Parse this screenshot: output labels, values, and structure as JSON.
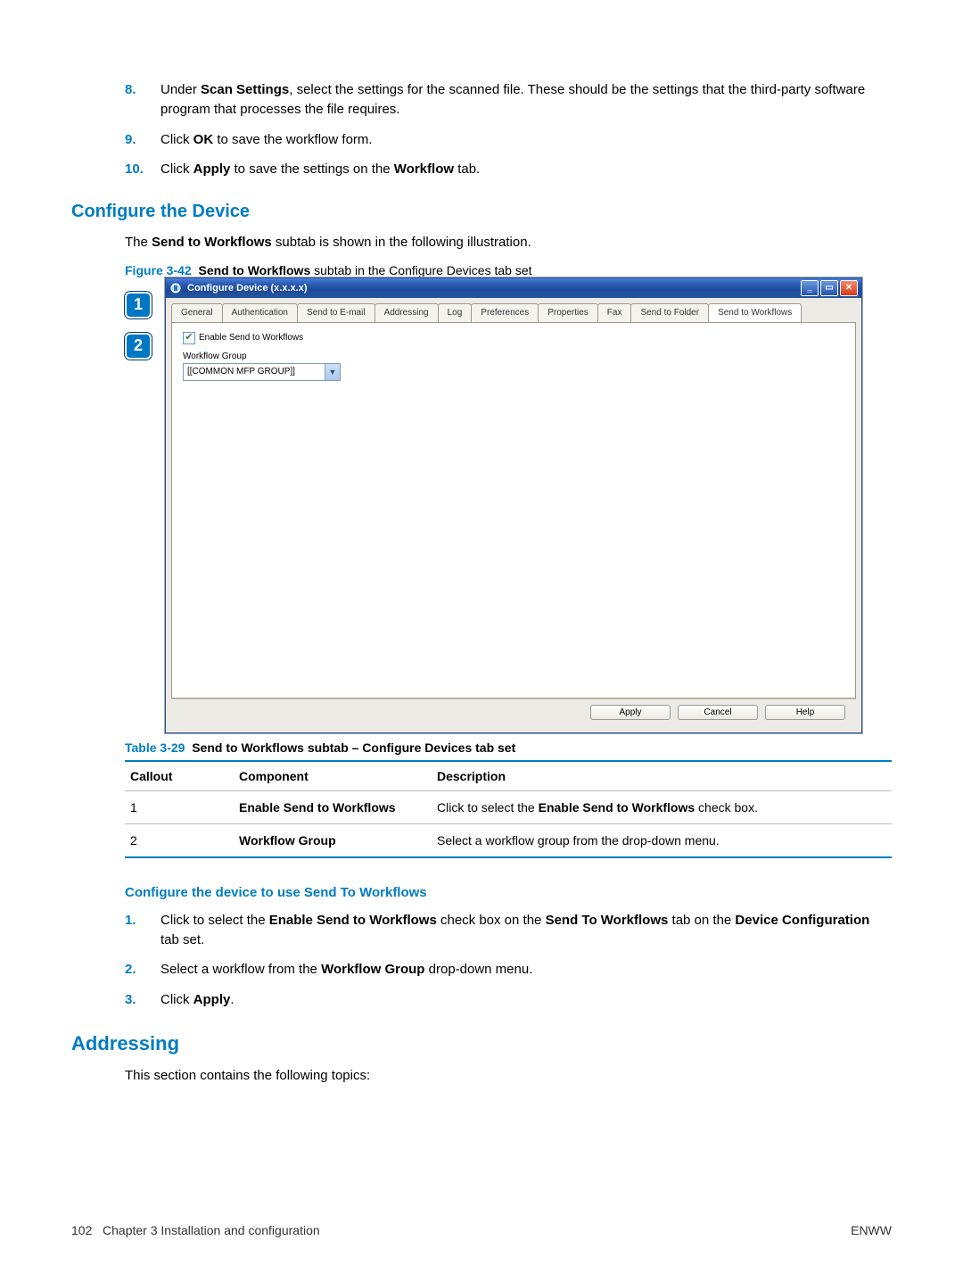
{
  "steps_top": [
    {
      "num": "8.",
      "html": "Under <b>Scan Settings</b>, select the settings for the scanned file. These should be the settings that the third-party software program that processes the file requires."
    },
    {
      "num": "9.",
      "html": "Click <b>OK</b> to save the workflow form."
    },
    {
      "num": "10.",
      "html": "Click <b>Apply</b> to save the settings on the <b>Workflow</b> tab."
    }
  ],
  "h2_configure_device": "Configure the Device",
  "p_subtab_intro_html": "The <b>Send to Workflows</b> subtab is shown in the following illustration.",
  "figure": {
    "num": "Figure 3-42",
    "caption_html": "<b>Send to Workflows</b> subtab in the Configure Devices tab set"
  },
  "window": {
    "title": "Configure Device (x.x.x.x)",
    "tabs": [
      "General",
      "Authentication",
      "Send to E-mail",
      "Addressing",
      "Log",
      "Preferences",
      "Properties",
      "Fax",
      "Send to Folder",
      "Send to Workflows"
    ],
    "active_tab_index": 9,
    "checkbox_label": "Enable Send to Workflows",
    "group_label": "Workflow Group",
    "group_value": "[[COMMON MFP GROUP]]",
    "buttons": {
      "apply": "Apply",
      "cancel": "Cancel",
      "help": "Help"
    }
  },
  "callouts": {
    "c1": "1",
    "c2": "2"
  },
  "table": {
    "num": "Table 3-29",
    "caption": "Send to Workflows subtab – Configure Devices tab set",
    "headers": [
      "Callout",
      "Component",
      "Description"
    ],
    "rows": [
      {
        "callout": "1",
        "component": "Enable Send to Workflows",
        "desc_html": "Click to select the <b>Enable Send to Workflows</b> check box."
      },
      {
        "callout": "2",
        "component": "Workflow Group",
        "desc_html": "Select a workflow group from the drop-down menu."
      }
    ]
  },
  "h3_configure_use": "Configure the device to use Send To Workflows",
  "steps_bottom": [
    {
      "num": "1.",
      "html": "Click to select the <b>Enable Send to Workflows</b> check box on the <b>Send To Workflows</b> tab on the <b>Device Configuration</b> tab set."
    },
    {
      "num": "2.",
      "html": "Select a workflow from the <b>Workflow Group</b> drop-down menu."
    },
    {
      "num": "3.",
      "html": "Click <b>Apply</b>."
    }
  ],
  "h2_addressing": "Addressing",
  "p_addressing_intro": "This section contains the following topics:",
  "footer": {
    "page_num": "102",
    "chapter": "Chapter 3   Installation and configuration",
    "right": "ENWW"
  }
}
